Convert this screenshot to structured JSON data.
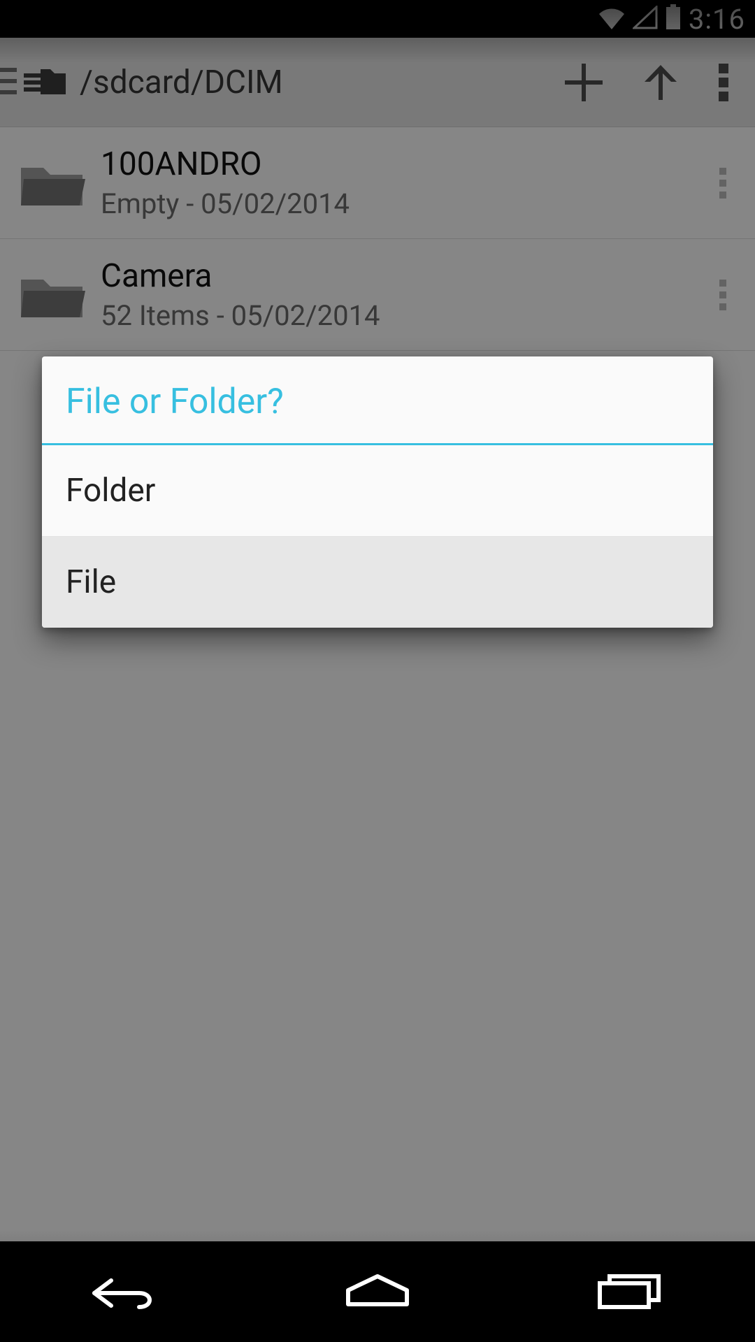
{
  "status": {
    "time": "3:16"
  },
  "actionbar": {
    "path": "/sdcard/DCIM"
  },
  "files": [
    {
      "name": "100ANDRO",
      "meta": "Empty - 05/02/2014"
    },
    {
      "name": "Camera",
      "meta": "52 Items - 05/02/2014"
    }
  ],
  "dialog": {
    "title": "File or Folder?",
    "options": [
      "Folder",
      "File"
    ]
  },
  "colors": {
    "accent": "#37bfe0"
  }
}
